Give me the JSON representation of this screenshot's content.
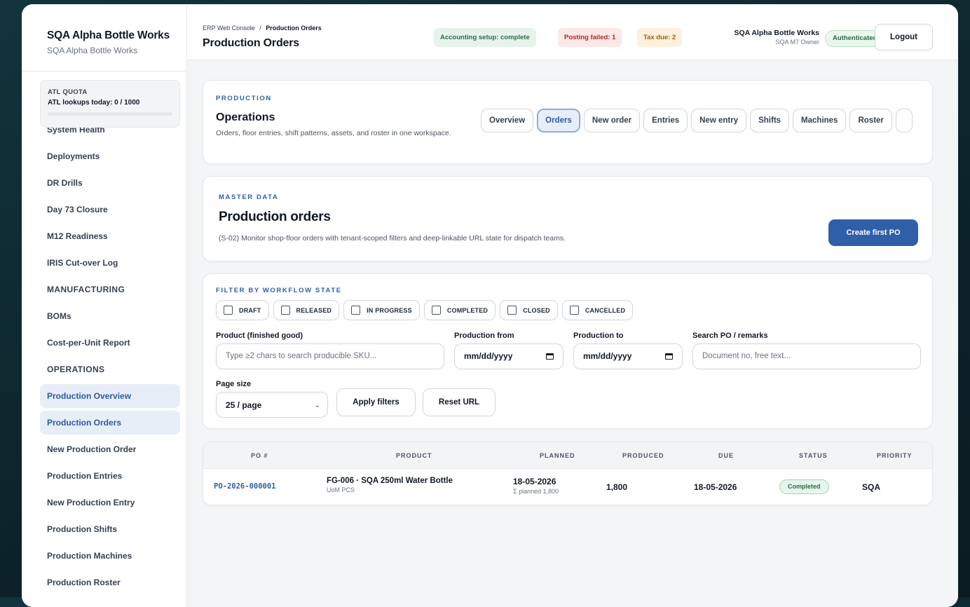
{
  "sidebar": {
    "brand_title": "SQA Alpha Bottle Works",
    "brand_sub": "SQA Alpha Bottle Works",
    "quota": {
      "title": "ATL QUOTA",
      "text": "ATL lookups today: 0 / 1000",
      "used_fraction": 0
    },
    "items": [
      {
        "label": "System Health",
        "type": "item"
      },
      {
        "label": "Deployments",
        "type": "item"
      },
      {
        "label": "DR Drills",
        "type": "item"
      },
      {
        "label": "Day 73 Closure",
        "type": "item"
      },
      {
        "label": "M12 Readiness",
        "type": "item"
      },
      {
        "label": "IRIS Cut-over Log",
        "type": "item"
      },
      {
        "label": "MANUFACTURING",
        "type": "section"
      },
      {
        "label": "BOMs",
        "type": "item"
      },
      {
        "label": "Cost-per-Unit Report",
        "type": "item"
      },
      {
        "label": "OPERATIONS",
        "type": "section"
      },
      {
        "label": "Production Overview",
        "type": "item",
        "active": true
      },
      {
        "label": "Production Orders",
        "type": "item",
        "active": true
      },
      {
        "label": "New Production Order",
        "type": "item"
      },
      {
        "label": "Production Entries",
        "type": "item"
      },
      {
        "label": "New Production Entry",
        "type": "item"
      },
      {
        "label": "Production Shifts",
        "type": "item"
      },
      {
        "label": "Production Machines",
        "type": "item"
      },
      {
        "label": "Production Roster",
        "type": "item"
      }
    ]
  },
  "header": {
    "breadcrumb_root": "ERP Web Console",
    "breadcrumb_sep": "/",
    "breadcrumb_current": "Production Orders",
    "title": "Production Orders",
    "pills": {
      "accounting": "Accounting setup: complete",
      "posting": "Posting failed: 1",
      "tax": "Tax due: 2"
    },
    "account_name": "SQA Alpha Bottle Works",
    "account_role": "SQA M7 Owner",
    "auth_status": "Authenticated",
    "logout_label": "Logout"
  },
  "operations": {
    "eyebrow": "PRODUCTION",
    "title": "Operations",
    "description": "Orders, floor entries, shift patterns, assets, and roster in one workspace.",
    "tabs": [
      "Overview",
      "Orders",
      "New order",
      "Entries",
      "New entry",
      "Shifts",
      "Machines",
      "Roster"
    ],
    "active_tab": "Orders"
  },
  "master": {
    "eyebrow": "MASTER DATA",
    "title": "Production orders",
    "description": "(S-02) Monitor shop-floor orders with tenant-scoped filters and deep-linkable URL state for dispatch teams.",
    "create_label": "Create first PO"
  },
  "filters": {
    "eyebrow": "FILTER BY WORKFLOW STATE",
    "states": [
      "DRAFT",
      "RELEASED",
      "IN PROGRESS",
      "COMPLETED",
      "CLOSED",
      "CANCELLED"
    ],
    "product_label": "Product (finished good)",
    "product_placeholder": "Type ≥2 chars to search producible SKU...",
    "from_label": "Production from",
    "from_value": "mm/dd/yyyy",
    "to_label": "Production to",
    "to_value": "mm/dd/yyyy",
    "search_label": "Search PO / remarks",
    "search_placeholder": "Document no, free text...",
    "page_size_label": "Page size",
    "page_size_value": "25 / page",
    "apply_label": "Apply filters",
    "reset_label": "Reset URL"
  },
  "table": {
    "columns": [
      "PO #",
      "PRODUCT",
      "PLANNED",
      "PRODUCED",
      "DUE",
      "STATUS",
      "PRIORITY"
    ],
    "rows": [
      {
        "po": "PO-2026-000001",
        "product": "FG-006 · SQA 250ml Water Bottle",
        "uom": "UoM PCS",
        "planned": "18-05-2026",
        "planned_sub": "Σ planned 1,800",
        "produced": "1,800",
        "due": "18-05-2026",
        "status": "Completed",
        "priority": "SQA"
      }
    ]
  }
}
